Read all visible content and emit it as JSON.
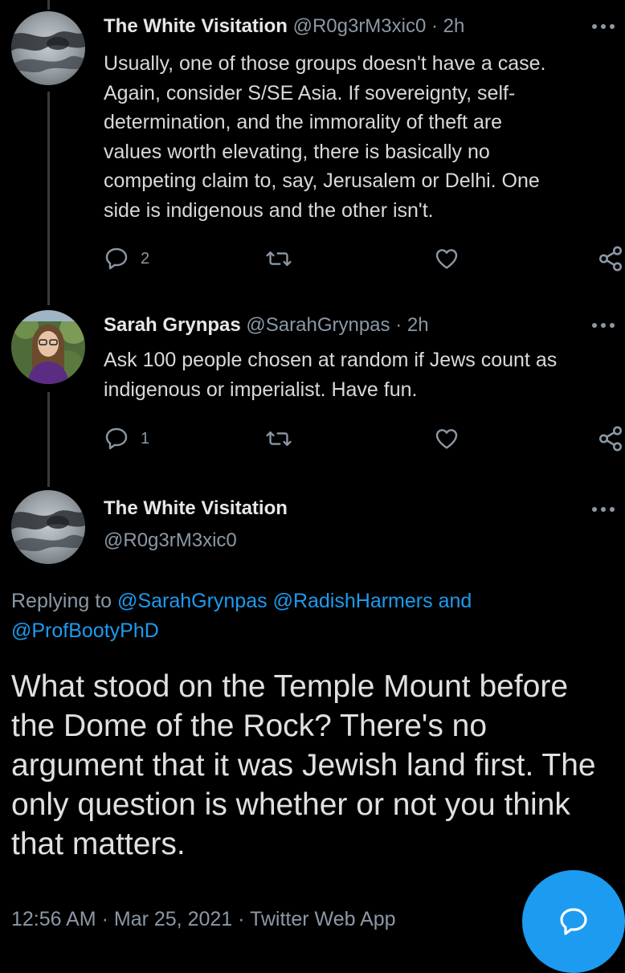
{
  "tweets": [
    {
      "name": "The White Visitation",
      "handle": "@R0g3rM3xic0",
      "separator": "·",
      "time": "2h",
      "text": "Usually, one of those groups doesn't have a case.\nAgain, consider S/SE Asia. If sovereignty, self-\ndetermination, and the immorality of theft are\nvalues worth elevating, there is basically no\ncompeting claim to, say, Jerusalem or Delhi. One\nside is indigenous and the other isn't.",
      "reply_count": "2",
      "avatar_icon": "cloudy-sky-avatar"
    },
    {
      "name": "Sarah Grynpas",
      "handle": "@SarahGrynpas",
      "separator": "·",
      "time": "2h",
      "text": "Ask 100 people chosen at random if Jews count as\nindigenous or imperialist. Have fun.",
      "reply_count": "1",
      "avatar_icon": "person-photo-avatar"
    }
  ],
  "main_tweet": {
    "name": "The White Visitation",
    "handle": "@R0g3rM3xic0",
    "replying_prefix": "Replying to",
    "mention_1": "@SarahGrynpas",
    "mention_2": "@RadishHarmers",
    "and_word": "and",
    "mention_3": "@ProfBootyPhD",
    "text": "What stood on the Temple Mount before the Dome of the Rock? There's no argument that it was Jewish land first. The only question is whether or not you think that matters.",
    "time": "12:56 AM",
    "date": "Mar 25, 2021",
    "separator": "·",
    "source": "Twitter Web App"
  },
  "colors": {
    "background": "#000000",
    "accent": "#1d9bf0",
    "secondary_text": "#8b98a5",
    "thread_line": "#3a3a3a"
  }
}
